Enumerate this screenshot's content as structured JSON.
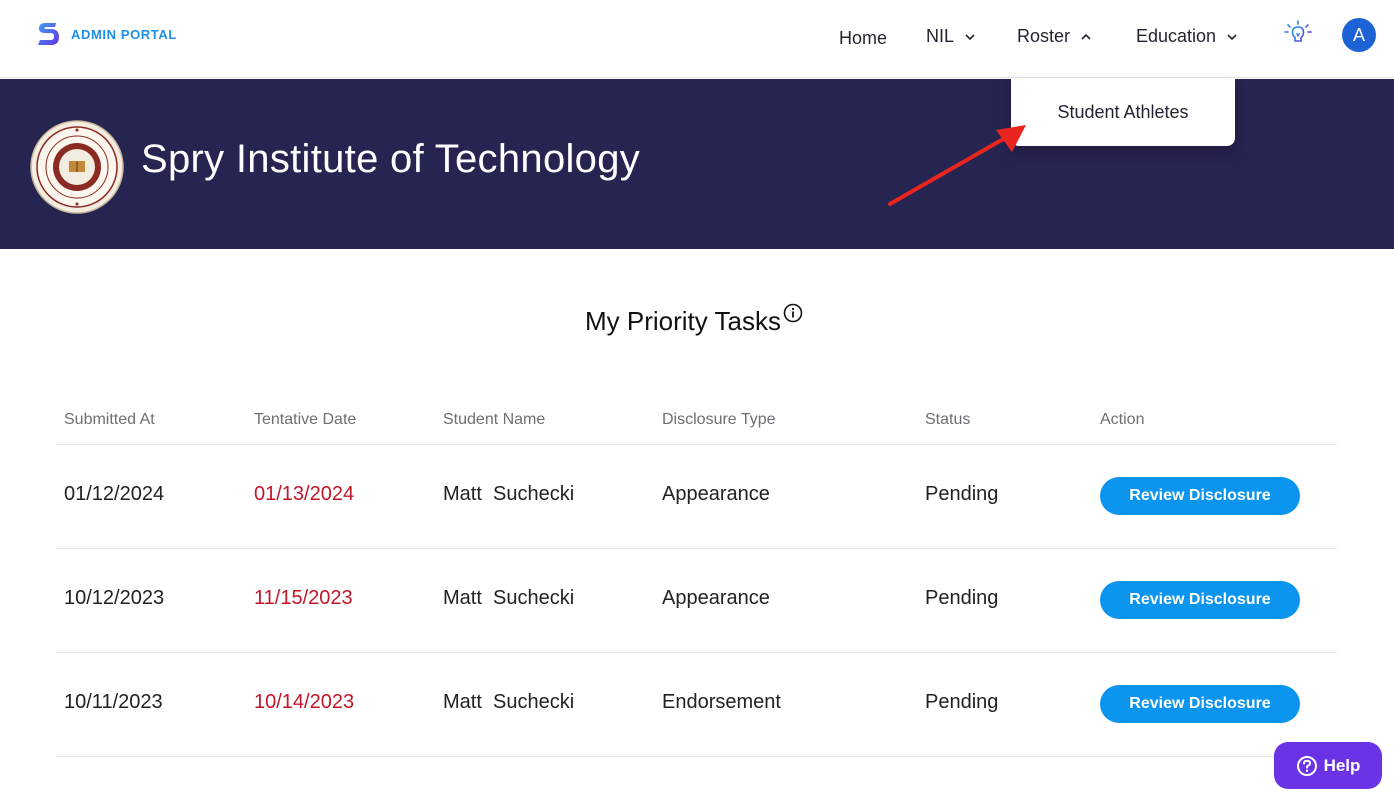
{
  "brand": {
    "title": "ADMIN PORTAL",
    "accent": "#1e8fe6"
  },
  "nav": {
    "home": "Home",
    "nil": "NIL",
    "roster": "Roster",
    "education": "Education",
    "avatar_initial": "A"
  },
  "roster_menu": {
    "items": [
      {
        "label": "Student Athletes"
      }
    ]
  },
  "hero": {
    "school_name": "Spry Institute of Technology",
    "background": "#262450"
  },
  "tasks": {
    "title": "My Priority Tasks",
    "columns": [
      "Submitted At",
      "Tentative Date",
      "Student Name",
      "Disclosure Type",
      "Status",
      "Action"
    ],
    "rows": [
      {
        "submitted_at": "01/12/2024",
        "tentative_date": "01/13/2024",
        "student_name": "Matt  Suchecki",
        "disclosure_type": "Appearance",
        "status": "Pending",
        "action": "Review Disclosure"
      },
      {
        "submitted_at": "10/12/2023",
        "tentative_date": "11/15/2023",
        "student_name": "Matt  Suchecki",
        "disclosure_type": "Appearance",
        "status": "Pending",
        "action": "Review Disclosure"
      },
      {
        "submitted_at": "10/11/2023",
        "tentative_date": "10/14/2023",
        "student_name": "Matt  Suchecki",
        "disclosure_type": "Endorsement",
        "status": "Pending",
        "action": "Review Disclosure"
      }
    ]
  },
  "help": {
    "label": "Help",
    "color": "#6a34e6"
  },
  "icons": {
    "bulb": "lightbulb-icon",
    "info": "info-icon",
    "chevron_down": "chevron-down-icon",
    "chevron_up": "chevron-up-icon",
    "question": "question-icon"
  },
  "colors": {
    "date_red": "#c4162a",
    "button_blue": "#0b95ee"
  }
}
